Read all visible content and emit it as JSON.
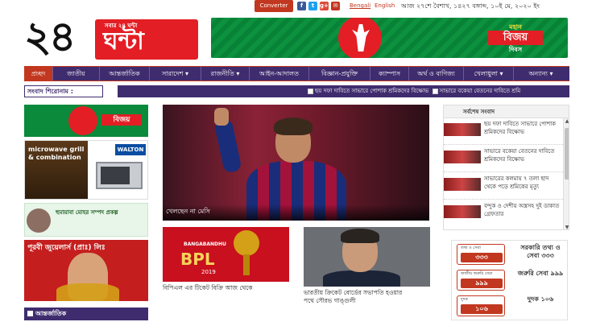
{
  "topbar": {
    "converter_label": "Converter",
    "social_icons": [
      "facebook-icon",
      "twitter-icon",
      "google-plus-icon",
      "email-icon"
    ],
    "lang_bengali": "Bengali",
    "lang_english": "English",
    "date": "আজ ২৭শে বৈশাখ, ১৪২৭ বঙ্গাব্দ, ১০ই মে, ২০২০ ইং"
  },
  "logo": {
    "number": "২৪",
    "tagline": "সবার ২৪ ঘন্টা",
    "word": "ঘন্টা"
  },
  "banner": {
    "subtitle": "মহান",
    "title": "বিজয়",
    "day": "দিবস"
  },
  "nav": {
    "items": [
      "প্রচ্ছদ",
      "জাতীয়",
      "আন্তর্জাতিক",
      "সারাদেশ ▾",
      "রাজনীতি ▾",
      "আইন-আদালত",
      "বিজ্ঞান-প্রযুক্তি",
      "ক্যাম্পাস",
      "অর্থ ও বাণিজ্য",
      "খেলাধুলা ▾",
      "অন্যান্য ▾"
    ]
  },
  "ticker": {
    "label": "সংবাদ শিরোনাম :",
    "headlines": [
      "ছয় দফা দাবিতে সাভারে পোশাক শ্রমিকদের বিক্ষোভ",
      "সাভারে বকেয়া বেতনের দাবিতে শ্রমি"
    ]
  },
  "left_ads": {
    "bijoy": "বিজয়",
    "walton_brand": "WALTON",
    "walton_text": "microwave grill & combination",
    "zoho_text": "হুমায়াবা মোহর সম্পদ প্রকল্প",
    "jewel_text": "পূরবী জুয়েলার্স (প্রাঃ) লিঃ"
  },
  "section": {
    "international": "আন্তর্জাতিক"
  },
  "main_story": {
    "caption": "খেলছেন না মেসি"
  },
  "stories": [
    {
      "caption": "বিপিএল এর টিকেট বিক্রি আজ থেকে",
      "bpl_sub": "BANGABANDHU",
      "bpl_word": "BPL",
      "bpl_year": "2019"
    },
    {
      "caption_line1": "ভারতীয় ক্রিকেট বোর্ডের সভাপতি হওয়ার",
      "caption_line2": "পথে সৌরভ গাঙ্গুলী"
    }
  ],
  "latest": {
    "heading": "সর্বশেষ সংবাদ",
    "items": [
      "ছয় দফা দাবিতে সাভারে পোশাক শ্রমিকদের বিক্ষোভ",
      "সাভারে বকেয়া বেতনের দাবিতে শ্রমিকদের বিক্ষোভ",
      "সাভারের কলমায় ৭ তলা ছাদ থেকে পড়ে শ্রমিকের মৃত্যু",
      "বন্দুক ও দেশীয় অস্ত্রসহ দুই ডাকাত গ্রেফতার"
    ]
  },
  "hotlines": [
    {
      "small": "তথ্য ও সেবা",
      "number": "৩৩৩",
      "label": "সরকারি তথ্য ও সেবা ৩৩৩"
    },
    {
      "small": "জাতীয় জরুরি সেবা",
      "number": "৯৯৯",
      "label": "জরুরি সেবা ৯৯৯"
    },
    {
      "small": "দুদক",
      "number": "১০৬",
      "label": "দুদক ১০৬"
    }
  ]
}
